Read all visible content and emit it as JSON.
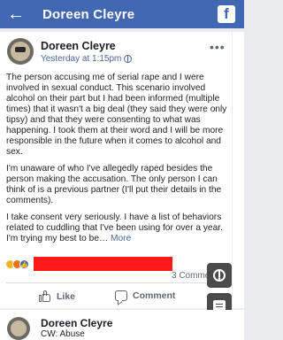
{
  "topbar": {
    "back_icon": "arrow-left-icon",
    "title": "Doreen Cleyre",
    "brand_icon": "f",
    "brand_color": "#4267b2"
  },
  "post": {
    "author": "Doreen Cleyre",
    "timestamp": "Yesterday at 1:15pm",
    "paragraphs": [
      "The person accusing me of serial rape and I were involved in sexual conduct. This scenario involved alcohol on their part but I had been informed (multiple times) that it wasn't a big deal (they said they were only tipsy) and that they were consenting to what was happening. I took them at their word and I will be more responsible in the future when it comes to alcohol and sex.",
      "I'm unaware of who I've allegedly raped besides the person making the accusation. The only person I can think of is a previous partner (I'll put their details in the comments).",
      "I take consent very seriously. I have a list of behaviors related to cuddling that I've been using for over a year. I'm trying my best to be…"
    ],
    "more_link": "More",
    "comments_count": "3 Comme",
    "redaction_color": "#ff1a1a",
    "reactions": [
      "sad",
      "angry",
      "like"
    ],
    "actions": {
      "like": "Like",
      "comment": "Comment"
    }
  },
  "next_post": {
    "author": "Doreen Cleyre",
    "cw": "CW: Abuse"
  }
}
